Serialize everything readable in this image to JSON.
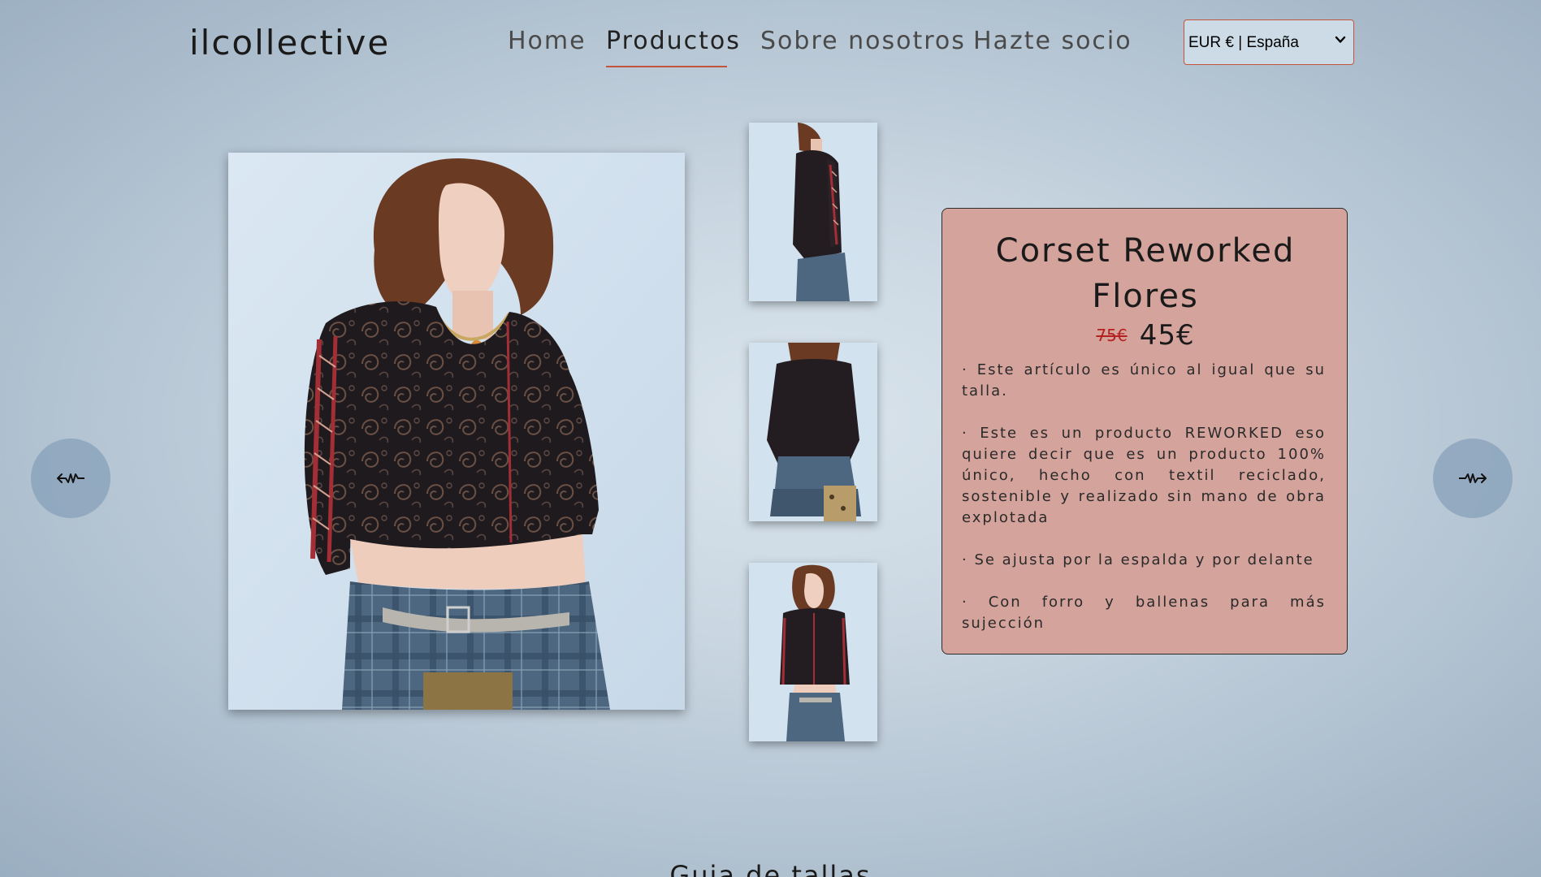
{
  "header": {
    "logo": "ilcollective",
    "nav": [
      {
        "label": "Home",
        "active": false
      },
      {
        "label": "Productos",
        "active": true
      },
      {
        "label": "Sobre nosotros",
        "active": false
      },
      {
        "label": "Hazte socio",
        "active": false
      }
    ],
    "currency_select": {
      "value": "EUR € | España"
    }
  },
  "product": {
    "title_line1": "Corset Reworked",
    "title_line2": "Flores",
    "old_price": "75€",
    "new_price": "45€",
    "description": [
      "· Este artículo es único al igual que su talla.",
      "· Este es un producto REWORKED eso quiere decir que es un producto 100% único, hecho con textil reciclado, sostenible y realizado sin mano de obra explotada",
      "· Se ajusta por la espalda y por delante",
      "· Con forro y ballenas para más sujección"
    ]
  },
  "gallery": {
    "thumbnail_count": 3
  },
  "size_guide_heading": "Guia de tallas",
  "colors": {
    "accent": "#c2543e",
    "card_bg": "#d4a39c",
    "old_price": "#b52020"
  }
}
